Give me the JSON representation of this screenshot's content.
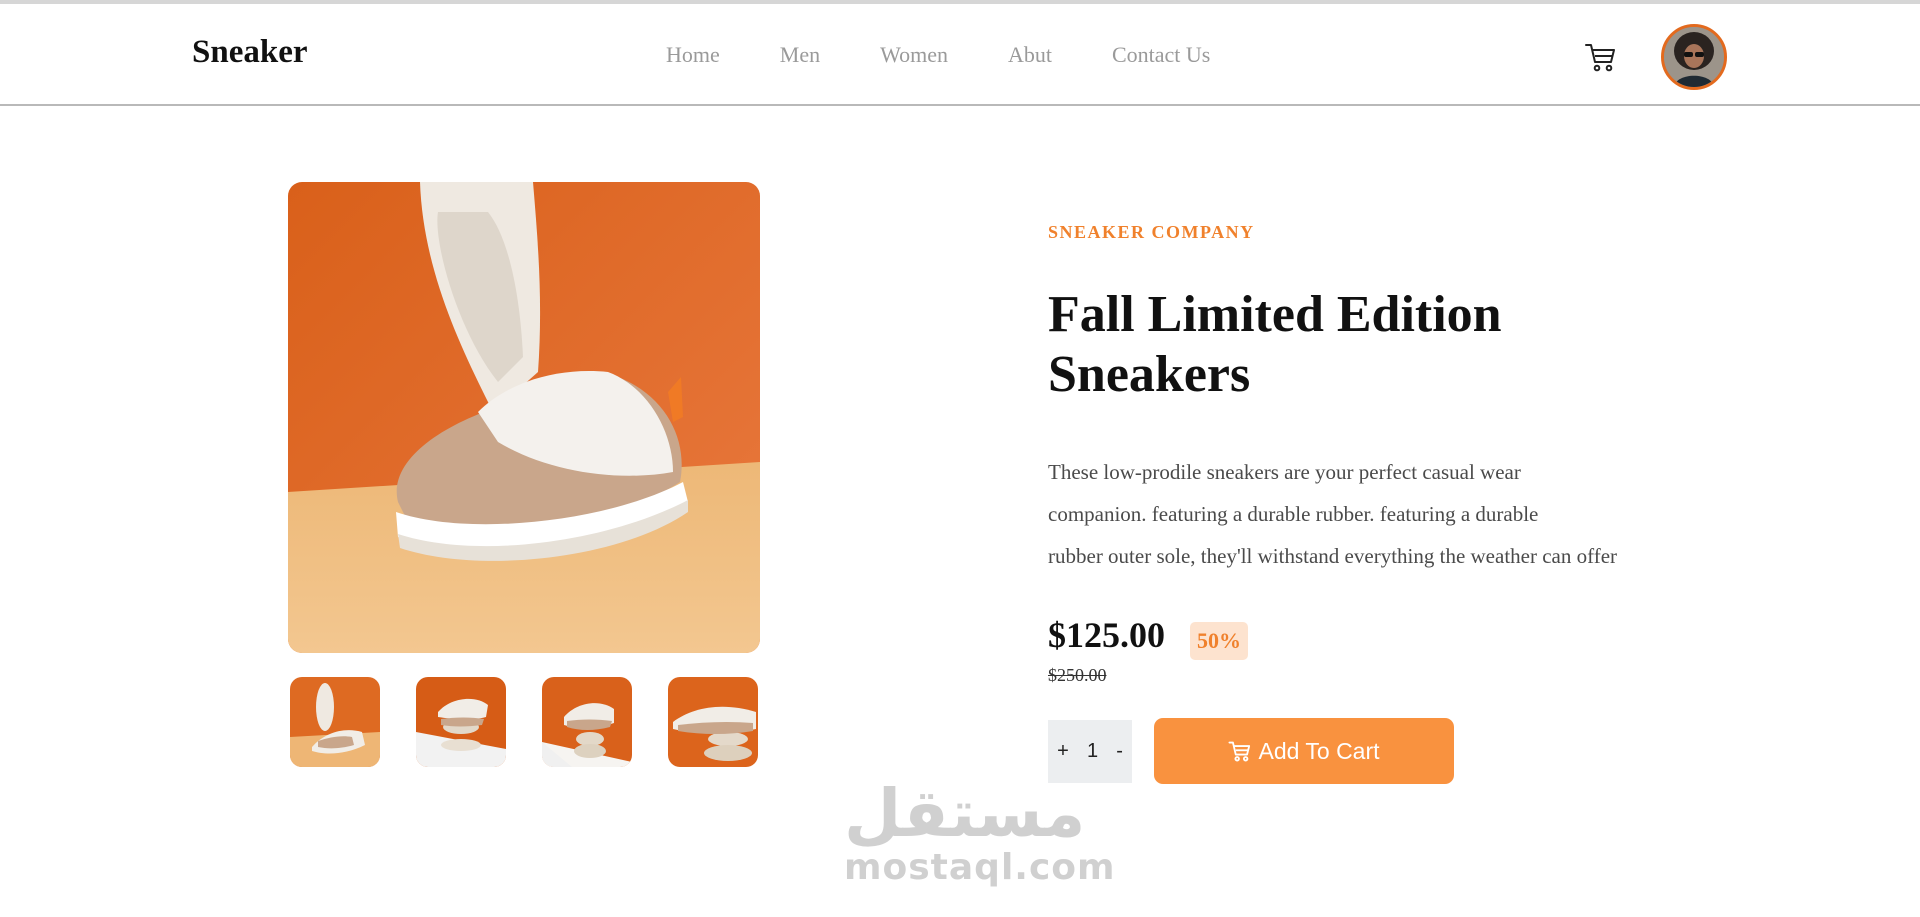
{
  "navbar": {
    "logo": "Sneaker",
    "links": [
      "Home",
      "Men",
      "Women",
      "Abut",
      "Contact Us"
    ],
    "cart_icon": "cart-icon",
    "avatar_icon": "user-avatar"
  },
  "product": {
    "company": "SNEAKER COMPANY",
    "title": "Fall Limited Edition Sneakers",
    "description_lines": [
      "These low-prodile sneakers are your perfect casual wear",
      "companion. featuring a durable rubber. featuring a durable",
      "rubber outer sole, they'll withstand everything the weather can offer"
    ],
    "price": "$125.00",
    "discount": "50%",
    "old_price": "$250.00",
    "quantity": {
      "plus": "+",
      "value": "1",
      "minus": "-"
    },
    "add_to_cart_label": "Add To Cart",
    "thumbnail_count": 4
  },
  "watermark": {
    "arabic": "مستقل",
    "latin": "mostaql.com"
  },
  "colors": {
    "accent": "#f0812c",
    "button": "#f9923f",
    "discount_bg": "#fde3cf",
    "nav_text": "#9a9a9a"
  }
}
